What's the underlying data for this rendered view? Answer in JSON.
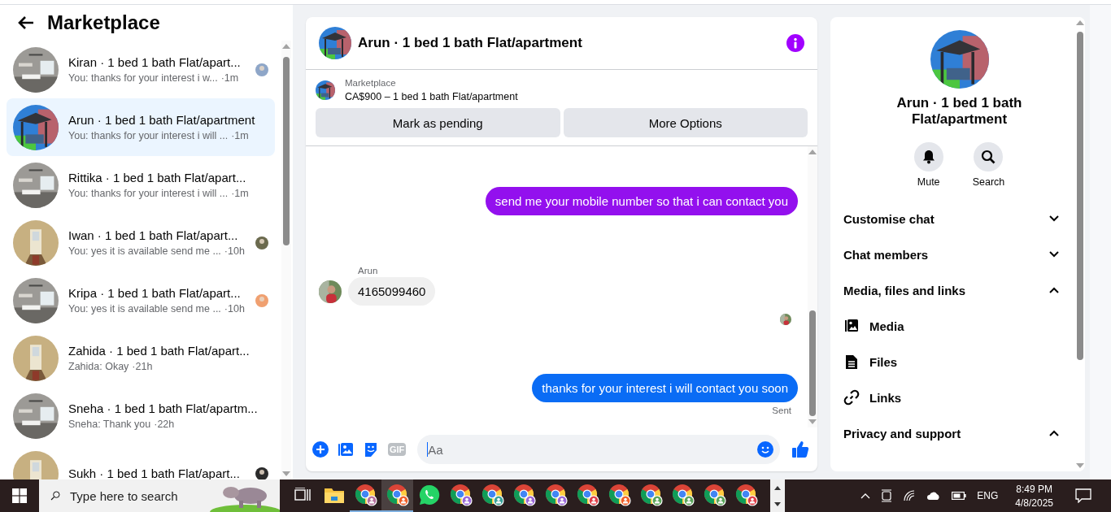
{
  "sidebar": {
    "title": "Marketplace",
    "conversations": [
      {
        "name": "Kiran · 1 bed 1 bath Flat/apart...",
        "preview": "You: thanks for your interest i w...",
        "time": "·1m",
        "selected": false,
        "receipt": {
          "color": "#8ea6c8"
        }
      },
      {
        "name": "Arun · 1 bed 1 bath Flat/apartment",
        "preview": "You: thanks for your interest i will ...",
        "time": "·1m",
        "selected": true
      },
      {
        "name": "Rittika · 1 bed 1 bath Flat/apart...",
        "preview": "You: thanks for your interest i will ...",
        "time": "·1m",
        "selected": false
      },
      {
        "name": "Iwan · 1 bed 1 bath Flat/apart...",
        "preview": "You: yes it is available send me ...",
        "time": "·10h",
        "selected": false,
        "receipt": {
          "color": "#6b6a4e"
        }
      },
      {
        "name": "Kripa · 1 bed 1 bath Flat/apart...",
        "preview": "You: yes it is available send me ...",
        "time": "·10h",
        "selected": false,
        "receipt": {
          "color": "#f0a070"
        }
      },
      {
        "name": "Zahida · 1 bed 1 bath Flat/apart...",
        "preview": "Zahida: Okay",
        "time": "·21h",
        "selected": false
      },
      {
        "name": "Sneha · 1 bed 1 bath Flat/apartm...",
        "preview": "Sneha: Thank you",
        "time": "·22h",
        "selected": false
      },
      {
        "name": "Sukh · 1 bed 1 bath Flat/apart...",
        "selected": false,
        "receipt": {
          "color": "#2b2b2b"
        }
      }
    ]
  },
  "chat": {
    "title": "Arun · 1 bed 1 bath Flat/apartment",
    "listing": {
      "label": "Marketplace",
      "summary": "CA$900 – 1 bed 1 bath Flat/apartment",
      "buttons": [
        "Mark as pending",
        "More Options"
      ]
    },
    "messages": [
      {
        "kind": "outgoing",
        "text": "send me your mobile number so that i can contact you",
        "color": "#9310ee"
      },
      {
        "kind": "incoming",
        "sender": "Arun",
        "text": "4165099460"
      },
      {
        "kind": "seen"
      },
      {
        "kind": "outgoing",
        "text": "thanks for your interest i will contact you soon",
        "color": "#0a6cf5",
        "status": "Sent"
      }
    ],
    "composer": {
      "gif": "GIF",
      "placeholder": "Aa"
    }
  },
  "details": {
    "title": "Arun · 1 bed 1 bath Flat/apartment",
    "actions": [
      {
        "label": "Mute"
      },
      {
        "label": "Search"
      }
    ],
    "sections": [
      {
        "label": "Customise chat",
        "expanded": false
      },
      {
        "label": "Chat members",
        "expanded": false
      },
      {
        "label": "Media, files and links",
        "expanded": true,
        "items": [
          {
            "label": "Media"
          },
          {
            "label": "Files"
          },
          {
            "label": "Links"
          }
        ]
      },
      {
        "label": "Privacy and support",
        "expanded": true
      }
    ]
  },
  "taskbar": {
    "search_placeholder": "Type here to search",
    "apps": [
      {
        "kind": "taskview",
        "running": false,
        "selected": false
      },
      {
        "kind": "folder",
        "running": false,
        "selected": false
      },
      {
        "kind": "browser",
        "color": "#b5709c",
        "running": true,
        "selected": false
      },
      {
        "kind": "browser",
        "color": "#f0602a",
        "running": true,
        "selected": true
      },
      {
        "kind": "chat",
        "running": false,
        "selected": false
      },
      {
        "kind": "browser",
        "color": "#9a68d8",
        "running": false,
        "selected": false
      },
      {
        "kind": "browser",
        "color": "#3aa39a",
        "running": false,
        "selected": false
      },
      {
        "kind": "browser",
        "color": "#9a68d8",
        "running": false,
        "selected": false
      },
      {
        "kind": "browser",
        "color": "#9a68d8",
        "running": false,
        "selected": false
      },
      {
        "kind": "browser",
        "color": "#e0404a",
        "running": false,
        "selected": false
      },
      {
        "kind": "browser",
        "color": "#f0602a",
        "running": false,
        "selected": false
      },
      {
        "kind": "browser",
        "color": "#5aa55a",
        "running": false,
        "selected": false
      },
      {
        "kind": "browser",
        "color": "#5aa55a",
        "running": false,
        "selected": false
      },
      {
        "kind": "browser",
        "color": "#5aa55a",
        "running": false,
        "selected": false
      },
      {
        "kind": "browser",
        "color": "#e0404a",
        "running": false,
        "selected": false
      }
    ],
    "language": "ENG",
    "time": "8:49 PM",
    "date": "4/8/2025"
  }
}
